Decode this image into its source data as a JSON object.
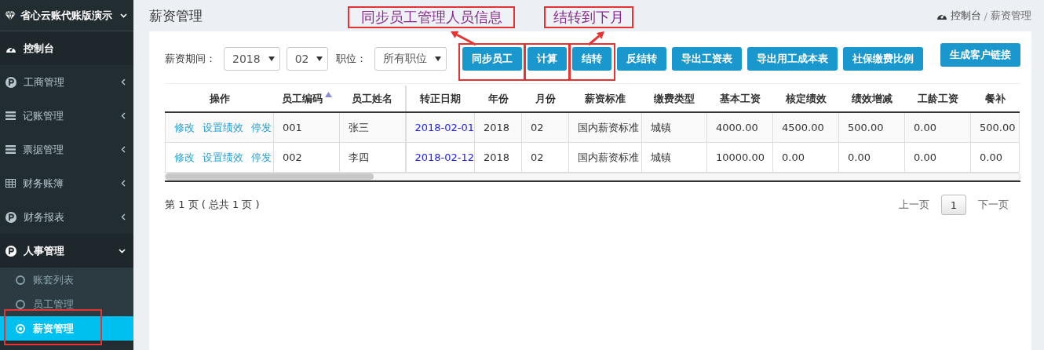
{
  "sidebar": {
    "brand": "省心云账代账版演示",
    "items": [
      {
        "label": "控制台",
        "kind": "dashboard",
        "active": true,
        "expandable": false
      },
      {
        "label": "工商管理",
        "kind": "coin",
        "active": false,
        "expandable": true,
        "expanded": false
      },
      {
        "label": "记账管理",
        "kind": "bars",
        "active": false,
        "expandable": true,
        "expanded": false
      },
      {
        "label": "票据管理",
        "kind": "bars",
        "active": false,
        "expandable": true,
        "expanded": false
      },
      {
        "label": "财务账簿",
        "kind": "grid",
        "active": false,
        "expandable": true,
        "expanded": false
      },
      {
        "label": "财务报表",
        "kind": "coin",
        "active": false,
        "expandable": true,
        "expanded": false
      },
      {
        "label": "人事管理",
        "kind": "coin",
        "active": true,
        "expandable": true,
        "expanded": true,
        "children": [
          {
            "label": "账套列表",
            "selected": false,
            "marked": false
          },
          {
            "label": "员工管理",
            "selected": false,
            "marked": false
          },
          {
            "label": "薪资管理",
            "selected": true,
            "marked": true
          }
        ]
      }
    ]
  },
  "header": {
    "title": "薪资管理",
    "breadcrumb": [
      "控制台",
      "薪资管理"
    ],
    "breadcrumb_separator": "/"
  },
  "filters": {
    "period_label": "薪资期间：",
    "year": "2018",
    "month": "02",
    "position_label": "职位：",
    "position": "所有职位"
  },
  "buttons": [
    {
      "label": "同步员工",
      "marked": true
    },
    {
      "label": "计算",
      "marked": true
    },
    {
      "label": "结转",
      "marked": true
    },
    {
      "label": "反结转",
      "marked": false
    },
    {
      "label": "导出工资表",
      "marked": false
    },
    {
      "label": "导出用工成本表",
      "marked": false
    },
    {
      "label": "社保缴费比例",
      "marked": false
    }
  ],
  "link_button": "生成客户链接",
  "annotations": [
    {
      "text": "同步员工管理人员信息"
    },
    {
      "text": "结转到下月"
    }
  ],
  "table": {
    "action_column": "操作",
    "columns": [
      {
        "label": "员工编码",
        "sorted": true
      },
      {
        "label": "员工姓名",
        "sorted": false
      },
      {
        "label": "转正日期",
        "sorted": false
      },
      {
        "label": "年份",
        "sorted": false
      },
      {
        "label": "月份",
        "sorted": false
      },
      {
        "label": "薪资标准",
        "sorted": false
      },
      {
        "label": "缴费类型",
        "sorted": false
      },
      {
        "label": "基本工资",
        "sorted": false
      },
      {
        "label": "核定绩效",
        "sorted": false
      },
      {
        "label": "绩效增减",
        "sorted": false
      },
      {
        "label": "工龄工资",
        "sorted": false
      },
      {
        "label": "餐补",
        "sorted": false
      }
    ],
    "rows": [
      {
        "actions": [
          "修改",
          "设置绩效",
          "停发"
        ],
        "cells": [
          "001",
          "张三",
          "2018-02-01",
          "2018",
          "02",
          "国内薪资标准",
          "城镇",
          "4000.00",
          "4500.00",
          "500.00",
          "0.00",
          "500.00"
        ]
      },
      {
        "actions": [
          "修改",
          "设置绩效",
          "停发"
        ],
        "cells": [
          "002",
          "李四",
          "2018-02-12",
          "2018",
          "02",
          "国内薪资标准",
          "城镇",
          "10000.00",
          "0.00",
          "0.00",
          "0.00",
          "0.00"
        ]
      }
    ]
  },
  "pagination": {
    "info": "第 1 页 ( 总共 1 页 )",
    "prev": "上一页",
    "pages": [
      {
        "label": "1",
        "selected": true
      }
    ],
    "next": "下一页"
  }
}
